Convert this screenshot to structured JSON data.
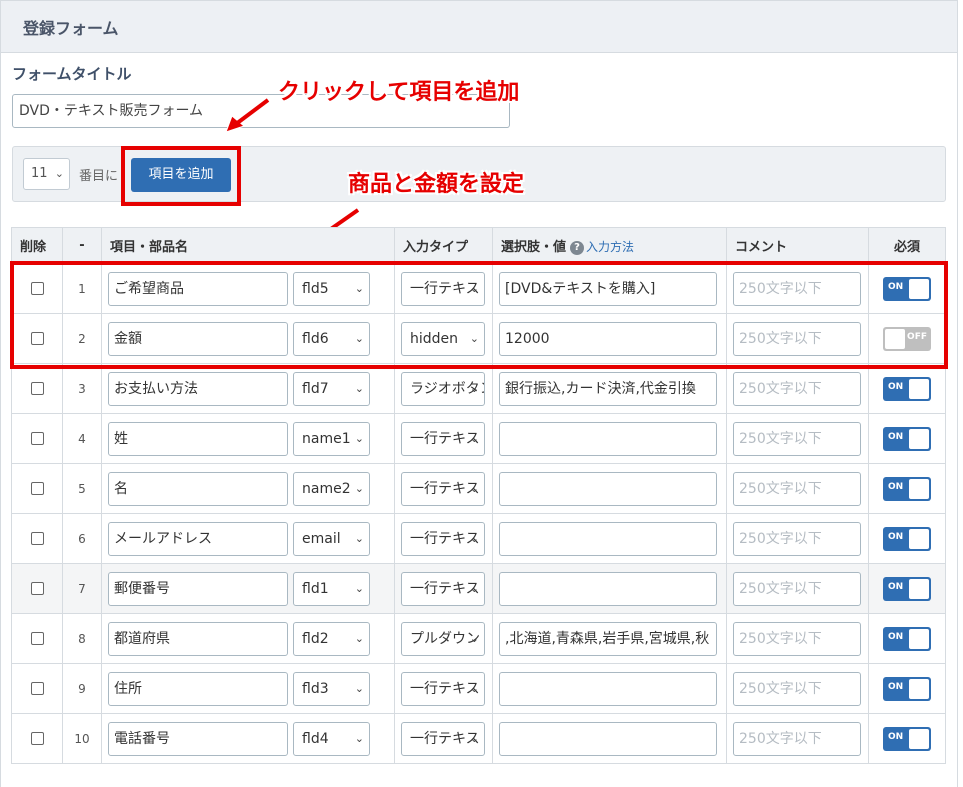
{
  "header": {
    "title": "登録フォーム"
  },
  "form_title": {
    "label": "フォームタイトル",
    "value": "DVD・テキスト販売フォーム"
  },
  "toolbar": {
    "position_value": "11",
    "position_suffix": "番目に",
    "add_button_label": "項目を追加"
  },
  "annotations": {
    "add_item": "クリックして項目を追加",
    "set_product_price": "商品と金額を設定"
  },
  "table": {
    "headers": {
      "delete": "削除",
      "number": "-",
      "item_name": "項目・部品名",
      "input_type": "入力タイプ",
      "choices": "選択肢・値",
      "choices_help": "入力方法",
      "comment": "コメント",
      "required": "必須"
    },
    "comment_placeholder": "250文字以下",
    "rows": [
      {
        "no": "1",
        "name": "ご希望商品",
        "field": "fld5",
        "type": "一行テキスト",
        "choices": "[DVD&テキストを購入]",
        "required": "ON"
      },
      {
        "no": "2",
        "name": "金額",
        "field": "fld6",
        "type": "hidden",
        "choices": "12000",
        "required": "OFF"
      },
      {
        "no": "3",
        "name": "お支払い方法",
        "field": "fld7",
        "type": "ラジオボタン",
        "choices": "銀行振込,カード決済,代金引換",
        "required": "ON"
      },
      {
        "no": "4",
        "name": "姓",
        "field": "name1",
        "type": "一行テキスト",
        "choices": "",
        "required": "ON"
      },
      {
        "no": "5",
        "name": "名",
        "field": "name2",
        "type": "一行テキスト",
        "choices": "",
        "required": "ON"
      },
      {
        "no": "6",
        "name": "メールアドレス",
        "field": "email",
        "type": "一行テキスト",
        "choices": "",
        "required": "ON"
      },
      {
        "no": "7",
        "name": "郵便番号",
        "field": "fld1",
        "type": "一行テキスト",
        "choices": "",
        "required": "ON"
      },
      {
        "no": "8",
        "name": "都道府県",
        "field": "fld2",
        "type": "プルダウン",
        "choices": ",北海道,青森県,岩手県,宮城県,秋",
        "required": "ON"
      },
      {
        "no": "9",
        "name": "住所",
        "field": "fld3",
        "type": "一行テキスト",
        "choices": "",
        "required": "ON"
      },
      {
        "no": "10",
        "name": "電話番号",
        "field": "fld4",
        "type": "一行テキスト",
        "choices": "",
        "required": "ON"
      }
    ]
  },
  "colors": {
    "accent": "#2f6eb3",
    "annotation": "#e60000",
    "toggle_off": "#bfbfbf"
  }
}
